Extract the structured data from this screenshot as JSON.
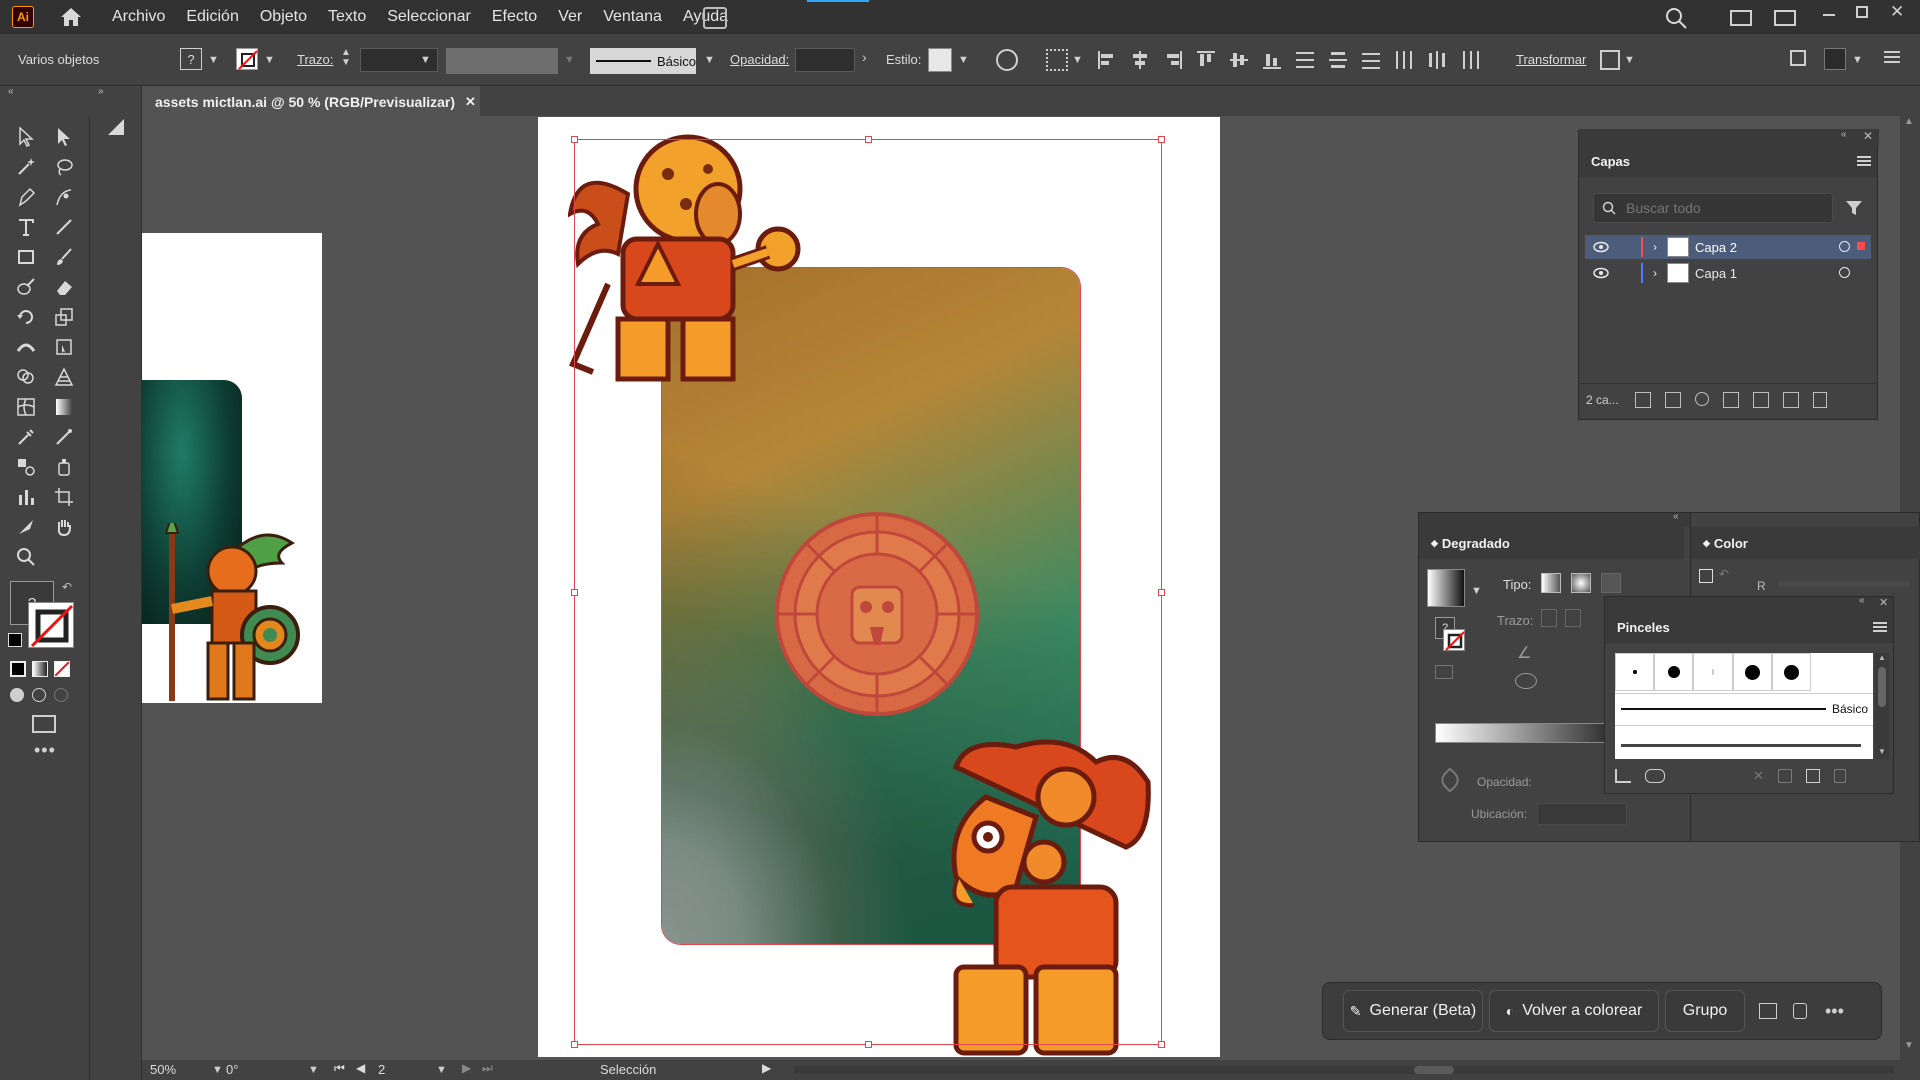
{
  "app": {
    "logo": "Ai"
  },
  "menu": [
    "Archivo",
    "Edición",
    "Objeto",
    "Texto",
    "Seleccionar",
    "Efecto",
    "Ver",
    "Ventana",
    "Ayuda"
  ],
  "control": {
    "selection": "Varios objetos",
    "stroke_label": "Trazo:",
    "brush": "Básico",
    "opacity_label": "Opacidad:",
    "style_label": "Estilo:",
    "transform": "Transformar"
  },
  "document": {
    "tab": "assets mictlan.ai @ 50 % (RGB/Previsualizar)",
    "close": "✕"
  },
  "layers": {
    "title": "Capas",
    "search_placeholder": "Buscar todo",
    "items": [
      {
        "name": "Capa 2",
        "color": "#ff4a4a"
      },
      {
        "name": "Capa 1",
        "color": "#4a7dff"
      }
    ],
    "count": "2 ca..."
  },
  "gradient": {
    "title": "Degradado",
    "type_label": "Tipo:",
    "stroke_label": "Trazo:",
    "opacity_label": "Opacidad:",
    "location_label": "Ubicación:"
  },
  "color": {
    "title": "Color",
    "r_label": "R"
  },
  "brushes": {
    "title": "Pinceles",
    "basic": "Básico"
  },
  "context": {
    "generate": "Generar (Beta)",
    "recolor": "Volver a colorear",
    "group": "Grupo"
  },
  "status": {
    "zoom": "50%",
    "rotation": "0°",
    "artboard": "2",
    "tool": "Selección"
  },
  "colors": {
    "accent": "#ff9a00",
    "selection": "#e2474b",
    "card_green": "#1f8a68",
    "card_orange": "#c87a2a"
  }
}
